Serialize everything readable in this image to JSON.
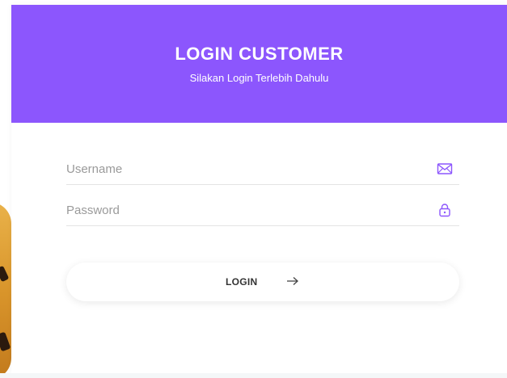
{
  "header": {
    "title": "LOGIN CUSTOMER",
    "subtitle": "Silakan Login Terlebih Dahulu"
  },
  "form": {
    "username": {
      "value": "",
      "placeholder": "Username",
      "icon": "envelope-icon"
    },
    "password": {
      "value": "",
      "placeholder": "Password",
      "icon": "lock-icon"
    },
    "submit": {
      "label": "LOGIN",
      "icon": "arrow-right-icon"
    }
  },
  "colors": {
    "header_bg": "#8c56fd",
    "accent": "#8c56fd",
    "text": "#333333",
    "placeholder": "#9a9a9a"
  }
}
